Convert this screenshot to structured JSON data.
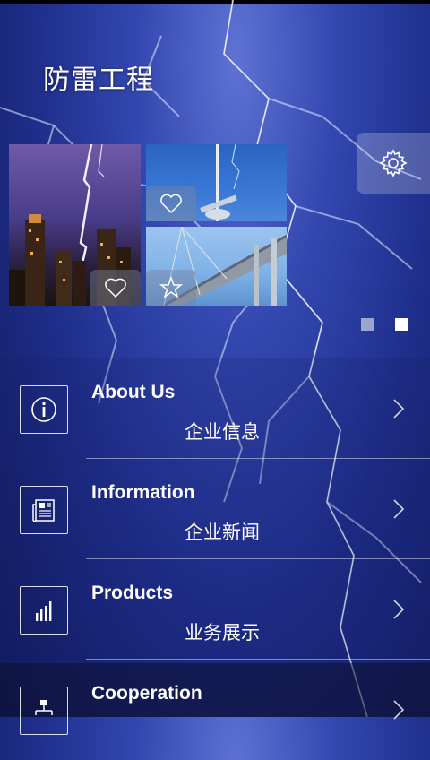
{
  "header": {
    "title": "防雷工程"
  },
  "settings": {
    "icon": "gear-icon"
  },
  "gallery": {
    "tiles": [
      {
        "name": "city-lightning-photo",
        "badge_icon": "heart-icon"
      },
      {
        "name": "lightning-rod-photo",
        "badge_icon": "heart-icon"
      },
      {
        "name": "bridge-photo",
        "badge_icon": "star-icon"
      }
    ]
  },
  "pager": {
    "count": 2,
    "active": 2
  },
  "menu": {
    "items": [
      {
        "en": "About Us",
        "zh": "企业信息",
        "icon": "info-icon"
      },
      {
        "en": "Information",
        "zh": "企业新闻",
        "icon": "newspaper-icon"
      },
      {
        "en": "Products",
        "zh": "业务展示",
        "icon": "bar-chart-icon"
      },
      {
        "en": "Cooperation",
        "zh": "",
        "icon": "org-chart-icon"
      }
    ]
  },
  "colors": {
    "background": "#2a3aa0",
    "accent": "#ffffff"
  }
}
